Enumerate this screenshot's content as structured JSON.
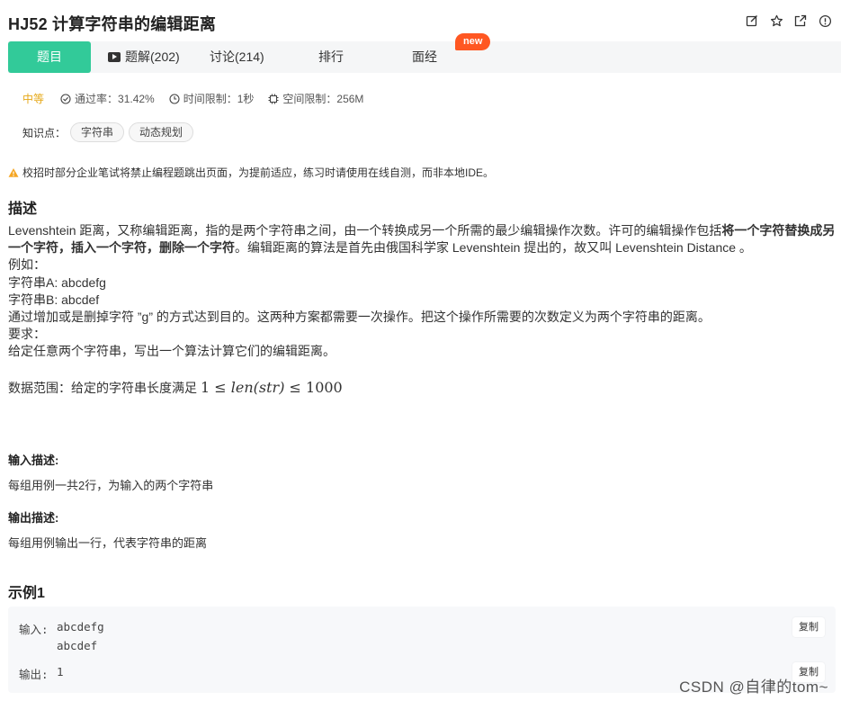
{
  "header": {
    "title": "HJ52  计算字符串的编辑距离",
    "icons": [
      "edit-icon",
      "star-icon",
      "share-icon",
      "report-icon"
    ]
  },
  "tabs": {
    "problem": "题目",
    "solution": "题解(202)",
    "discuss": "讨论(214)",
    "rank": "排行",
    "interview": "面经",
    "new_badge": "new"
  },
  "meta": {
    "difficulty": "中等",
    "pass_rate": "通过率：31.42%",
    "time_limit": "时间限制：1秒",
    "memory_limit": "空间限制：256M"
  },
  "tags": {
    "label": "知识点：",
    "items": [
      "字符串",
      "动态规划"
    ]
  },
  "warning": "校招时部分企业笔试将禁止编程题跳出页面，为提前适应，练习时请使用在线自测，而非本地IDE。",
  "description": {
    "heading": "描述",
    "p1_a": "Levenshtein 距离，又称编辑距离，指的是两个字符串之间，由一个转换成另一个所需的最少编辑操作次数。许可的编辑操作包括",
    "p1_bold": "将一个字符替换成另一个字符，插入一个字符，删除一个字符",
    "p1_b": "。编辑距离的算法是首先由俄国科学家 Levenshtein 提出的，故又叫 Levenshtein Distance 。",
    "line_example": "例如：",
    "line_a": "字符串A: abcdefg",
    "line_b": "字符串B: abcdef",
    "line_explain": "通过增加或是删掉字符 ”g” 的方式达到目的。这两种方案都需要一次操作。把这个操作所需要的次数定义为两个字符串的距离。",
    "line_req": "要求：",
    "line_task": "给定任意两个字符串，写出一个算法计算它们的编辑距离。",
    "range_label": "数据范围：给定的字符串长度满足 ",
    "math_lhs": "1 ≤ ",
    "math_func": "len",
    "math_arg": "(str)",
    "math_rhs": " ≤ 1000"
  },
  "input_desc": {
    "heading": "输入描述:",
    "text": "每组用例一共2行，为输入的两个字符串"
  },
  "output_desc": {
    "heading": "输出描述:",
    "text": "每组用例输出一行，代表字符串的距离"
  },
  "example": {
    "heading": "示例1",
    "input_label": "输入:",
    "input_line1": "abcdefg",
    "input_line2": "abcdef",
    "output_label": "输出:",
    "output_value": "1",
    "copy_label": "复制"
  },
  "watermark": "CSDN @自律的tom~"
}
